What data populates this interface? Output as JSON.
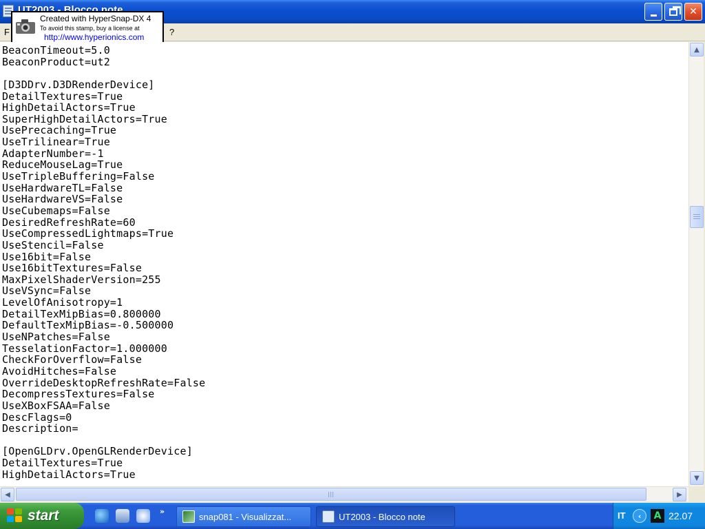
{
  "window": {
    "title": "UT2003 - Blocco note",
    "minimize_glyph": "_",
    "close_glyph": "✕"
  },
  "menu": {
    "file_label": "F",
    "help_label": "?"
  },
  "stamp": {
    "line1": "Created with HyperSnap-DX 4",
    "line2": "To avoid this stamp, buy a license at",
    "line3": "http://www.hyperionics.com"
  },
  "editor": {
    "lines": [
      "BeaconTimeout=5.0",
      "BeaconProduct=ut2",
      "",
      "[D3DDrv.D3DRenderDevice]",
      "DetailTextures=True",
      "HighDetailActors=True",
      "SuperHighDetailActors=True",
      "UsePrecaching=True",
      "UseTrilinear=True",
      "AdapterNumber=-1",
      "ReduceMouseLag=True",
      "UseTripleBuffering=False",
      "UseHardwareTL=False",
      "UseHardwareVS=False",
      "UseCubemaps=False",
      "DesiredRefreshRate=60",
      "UseCompressedLightmaps=True",
      "UseStencil=False",
      "Use16bit=False",
      "Use16bitTextures=False",
      "MaxPixelShaderVersion=255",
      "UseVSync=False",
      "LevelOfAnisotropy=1",
      "DetailTexMipBias=0.800000",
      "DefaultTexMipBias=-0.500000",
      "UseNPatches=False",
      "TesselationFactor=1.000000",
      "CheckForOverflow=False",
      "AvoidHitches=False",
      "OverrideDesktopRefreshRate=False",
      "DecompressTextures=False",
      "UseXBoxFSAA=False",
      "DescFlags=0",
      "Description=",
      "",
      "[OpenGLDrv.OpenGLRenderDevice]",
      "DetailTextures=True",
      "HighDetailActors=True"
    ]
  },
  "scrollbars": {
    "up_arrow": "▲",
    "down_arrow": "▼",
    "left_arrow": "◀",
    "right_arrow": "▶"
  },
  "taskbar": {
    "start_label": "start",
    "quicklaunch_more": "»",
    "tasks": [
      {
        "label": "snap081 - Visualizzat..."
      },
      {
        "label": "UT2003 - Blocco note"
      }
    ],
    "tray": {
      "language": "IT",
      "chevron": "‹",
      "app_glyph": "A",
      "clock": "22.07"
    }
  }
}
